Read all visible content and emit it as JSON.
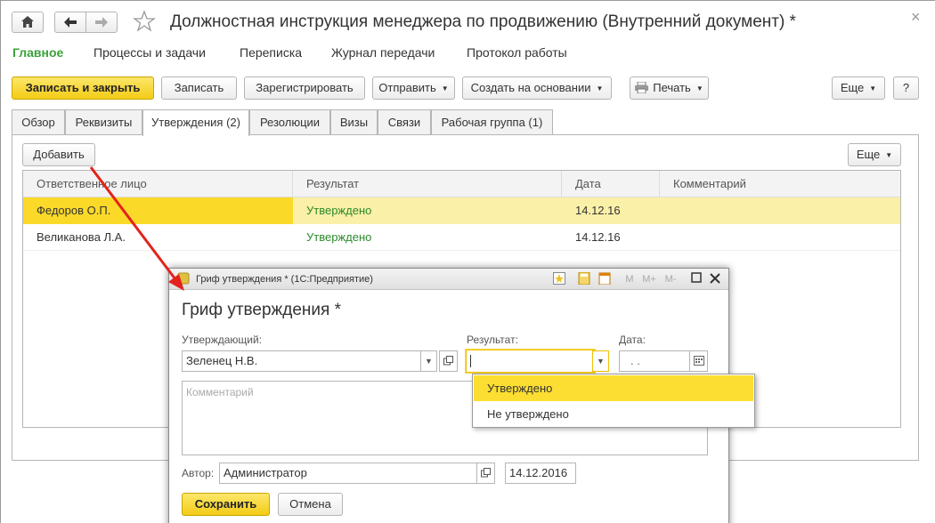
{
  "window": {
    "title": "Должностная инструкция менеджера по продвижению (Внутренний документ) *",
    "close_glyph": "×"
  },
  "topnav": [
    "Главное",
    "Процессы и задачи",
    "Переписка",
    "Журнал передачи",
    "Протокол работы"
  ],
  "toolbar": {
    "save_close": "Записать и закрыть",
    "save": "Записать",
    "register": "Зарегистрировать",
    "send": "Отправить",
    "create_based": "Создать на основании",
    "print": "Печать",
    "more": "Еще",
    "help": "?"
  },
  "tabs": [
    "Обзор",
    "Реквизиты",
    "Утверждения (2)",
    "Резолюции",
    "Визы",
    "Связи",
    "Рабочая группа (1)"
  ],
  "approvals": {
    "add_button": "Добавить",
    "more_button": "Еще",
    "columns": [
      "Ответственное лицо",
      "Результат",
      "Дата",
      "Комментарий"
    ],
    "rows": [
      {
        "person": "Федоров О.П.",
        "result": "Утверждено",
        "date": "14.12.16",
        "comment": ""
      },
      {
        "person": "Великанова Л.А.",
        "result": "Утверждено",
        "date": "14.12.16",
        "comment": ""
      }
    ]
  },
  "dialog": {
    "window_title": "Гриф утверждения * (1С:Предприятие)",
    "heading": "Гриф утверждения *",
    "title_icons": {
      "m": "M",
      "m_plus": "M+",
      "m_minus": "M-"
    },
    "approver_label": "Утверждающий:",
    "approver_value": "Зеленец Н.В.",
    "result_label": "Результат:",
    "date_label": "Дата:",
    "date_value": ". .",
    "comment_placeholder": "Комментарий",
    "author_label": "Автор:",
    "author_value": "Администратор",
    "author_date": "14.12.2016",
    "save_button": "Сохранить",
    "cancel_button": "Отмена"
  },
  "dropdown": {
    "options": [
      "Утверждено",
      "Не утверждено"
    ],
    "selected": "Утверждено"
  },
  "colors": {
    "accent_yellow": "#fbde31",
    "active_nav_green": "#3aa33a",
    "result_green": "#2b8a2b",
    "selected_row": "#fbe59a",
    "arrow_red": "#e3231c"
  },
  "icons": [
    "home-icon",
    "back-icon",
    "forward-icon",
    "star-icon",
    "print-icon",
    "calendar-icon",
    "calculator-icon",
    "open-icon",
    "maximize-icon",
    "close-icon"
  ]
}
